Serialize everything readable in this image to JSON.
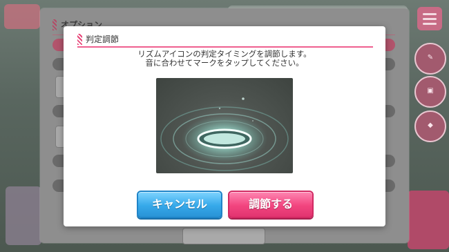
{
  "options_panel": {
    "title": "オプション"
  },
  "dialog": {
    "title": "判定調節",
    "instruction_lines": [
      "リズムアイコンの判定タイミングを調節します。",
      "音に合わせてマークをタップしてください。"
    ],
    "cancel_label": "キャンセル",
    "adjust_label": "調節する"
  },
  "colors": {
    "accent_pink": "#ef5f8e",
    "cancel_blue": "#36a9ea",
    "adjust_pink": "#f2457f",
    "ring_cyan": "#bff7ee"
  }
}
